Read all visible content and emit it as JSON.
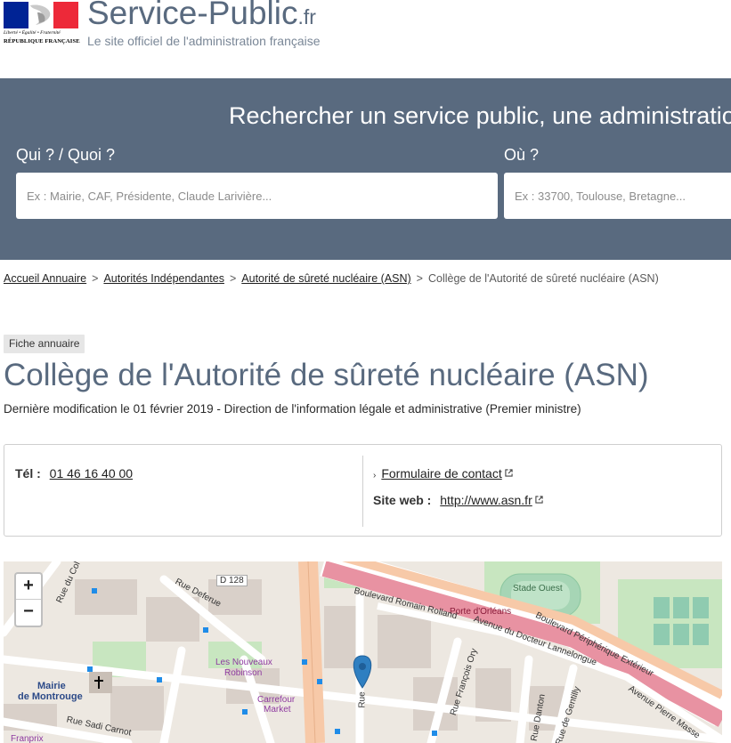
{
  "header": {
    "logo_motto": "Liberté • Égalité • Fraternité",
    "logo_rf": "RÉPUBLIQUE FRANÇAISE",
    "brand_name": "Service-Public",
    "brand_tld": ".fr",
    "tagline": "Le site officiel de l'administration française"
  },
  "search": {
    "title": "Rechercher un service public, une administration",
    "qui_label": "Qui ? / Quoi ?",
    "qui_placeholder": "Ex : Mairie, CAF, Présidente, Claude Larivière...",
    "ou_label": "Où ?",
    "ou_placeholder": "Ex : 33700, Toulouse, Bretagne..."
  },
  "breadcrumb": {
    "items": [
      "Accueil Annuaire",
      "Autorités Indépendantes",
      "Autorité de sûreté nucléaire (ASN)"
    ],
    "current": "Collège de l'Autorité de sûreté nucléaire (ASN)",
    "separator": ">"
  },
  "page": {
    "badge": "Fiche annuaire",
    "title": "Collège de l'Autorité de sûreté nucléaire (ASN)",
    "subtitle": "Dernière modification le 01 février 2019 - Direction de l'information légale et administrative (Premier ministre)"
  },
  "contact": {
    "tel_label": "Tél :",
    "tel_value": "01 46 16 40 00",
    "form_link": "Formulaire de contact",
    "site_label": "Site web :",
    "site_value": "http://www.asn.fr"
  },
  "map": {
    "zoom_in": "+",
    "zoom_out": "−",
    "labels": {
      "d128": "D 128",
      "rue_deferue": "Rue Deferue",
      "stade_ouest": "Stade Ouest",
      "porte_orleans": "Porte d'Orléans",
      "bd_romain_rolland": "Boulevard Romain Rolland",
      "av_lannelongue": "Avenue du Docteur Lannelongue",
      "bd_peripherique": "Boulevard Périphérique Extérieur",
      "les_nouveaux": "Les Nouveaux",
      "robinson": "Robinson",
      "carrefour": "Carrefour",
      "market": "Market",
      "mairie": "Mairie",
      "de_montrouge": "de Montrouge",
      "rue_sadi": "Rue Sadi Carnot",
      "franprix": "Franprix",
      "rue_francois_ory": "Rue François Ory",
      "rue_danton": "Rue Danton",
      "rue_gentilly": "Rue de Gentilly",
      "av_pierre": "Avenue Pierre Masse",
      "rue_vl": "Rue",
      "rue_col": "Rue du Col"
    },
    "colors": {
      "road_major": "#f7c9a8",
      "road_peripherique": "#e892a2",
      "green": "#c8e6c0",
      "stadium": "#a6d5b5",
      "building": "#d9d0c9",
      "marker": "#2f7fc1"
    }
  }
}
